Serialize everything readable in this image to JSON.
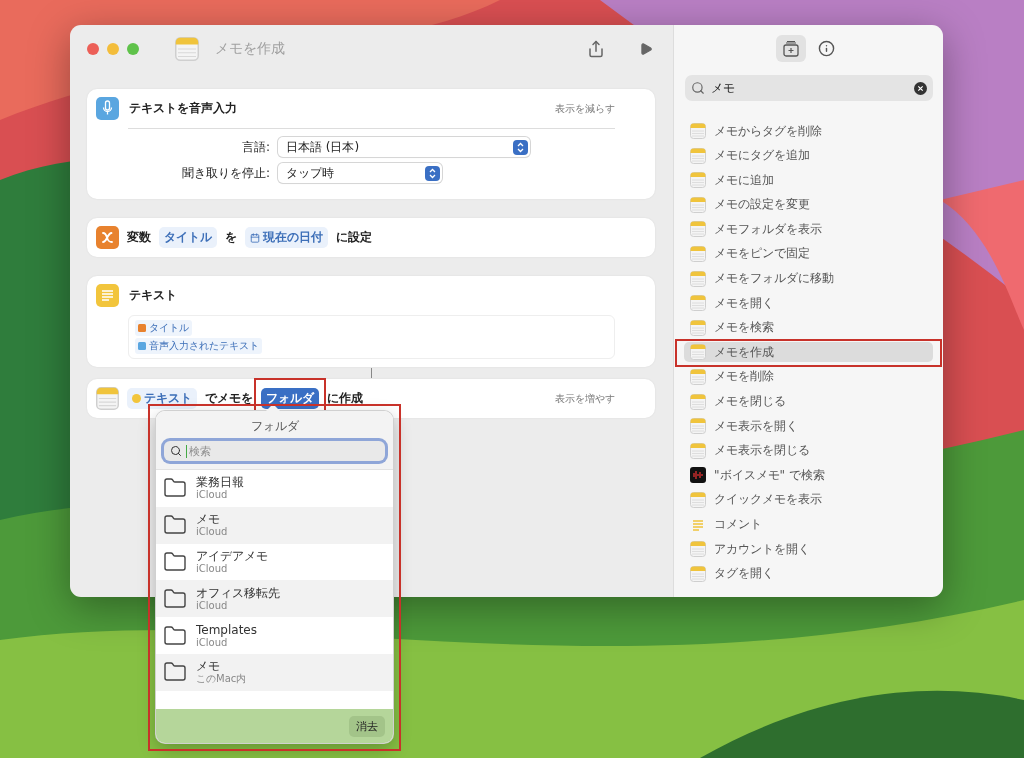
{
  "window": {
    "title": "メモを作成"
  },
  "actions": [
    {
      "kind": "dictate",
      "title": "テキストを音声入力",
      "toggle": "表示を減らす",
      "params": [
        {
          "label": "言語:",
          "value": "日本語 (日本)"
        },
        {
          "label": "聞き取りを停止:",
          "value": "タップ時"
        }
      ]
    },
    {
      "kind": "variable",
      "parts": [
        {
          "kind": "label",
          "text": "変数"
        },
        {
          "kind": "variable",
          "selected": false,
          "text": "タイトル"
        },
        {
          "kind": "label",
          "text": "を"
        },
        {
          "kind": "date",
          "selected": false,
          "text": "現在の日付"
        },
        {
          "kind": "label",
          "text": "に設定"
        }
      ]
    },
    {
      "kind": "text",
      "title": "テキスト",
      "lines": [
        {
          "kind": "variable",
          "text": "タイトル"
        },
        {
          "kind": "dictation",
          "text": "音声入力されたテキスト"
        }
      ]
    },
    {
      "kind": "note",
      "parts": [
        {
          "kind": "output",
          "selected": false,
          "text": "テキスト"
        },
        {
          "kind": "label",
          "text": "でメモを"
        },
        {
          "kind": "parameter",
          "selected": true,
          "text": "フォルダ"
        },
        {
          "kind": "label",
          "text": "に作成"
        }
      ],
      "toggle": "表示を増やす"
    }
  ],
  "folder_popover": {
    "title": "フォルダ",
    "search": {
      "placeholder": "検索"
    },
    "folders": [
      {
        "name": "業務日報",
        "account": "iCloud"
      },
      {
        "name": "メモ",
        "account": "iCloud"
      },
      {
        "name": "アイデアメモ",
        "account": "iCloud"
      },
      {
        "name": "オフィス移転先",
        "account": "iCloud"
      },
      {
        "name": "Templates",
        "account": "iCloud"
      },
      {
        "name": "メモ",
        "account": "このMac内"
      }
    ],
    "clear_button": "消去"
  },
  "library": {
    "tabs": [
      {
        "kind": "add",
        "selected": true
      },
      {
        "kind": "info",
        "selected": false
      }
    ],
    "search": {
      "value": "メモ"
    },
    "items": [
      {
        "kind": "notes",
        "label": "メモからタグを削除",
        "selected": false
      },
      {
        "kind": "notes",
        "label": "メモにタグを追加",
        "selected": false
      },
      {
        "kind": "notes",
        "label": "メモに追加",
        "selected": false
      },
      {
        "kind": "notes",
        "label": "メモの設定を変更",
        "selected": false
      },
      {
        "kind": "notes",
        "label": "メモフォルダを表示",
        "selected": false
      },
      {
        "kind": "notes",
        "label": "メモをピンで固定",
        "selected": false
      },
      {
        "kind": "notes",
        "label": "メモをフォルダに移動",
        "selected": false
      },
      {
        "kind": "notes",
        "label": "メモを開く",
        "selected": false
      },
      {
        "kind": "notes",
        "label": "メモを検索",
        "selected": false
      },
      {
        "kind": "notes",
        "label": "メモを作成",
        "selected": true
      },
      {
        "kind": "notes",
        "label": "メモを削除",
        "selected": false
      },
      {
        "kind": "notes",
        "label": "メモを閉じる",
        "selected": false
      },
      {
        "kind": "notes",
        "label": "メモ表示を開く",
        "selected": false
      },
      {
        "kind": "notes",
        "label": "メモ表示を閉じる",
        "selected": false
      },
      {
        "kind": "voicememo",
        "label": "\"ボイスメモ\" で検索",
        "selected": false
      },
      {
        "kind": "notes",
        "label": "クイックメモを表示",
        "selected": false
      },
      {
        "kind": "comment",
        "label": "コメント",
        "selected": false
      },
      {
        "kind": "notes",
        "label": "アカウントを開く",
        "selected": false
      },
      {
        "kind": "notes",
        "label": "タグを開く",
        "selected": false
      }
    ]
  }
}
